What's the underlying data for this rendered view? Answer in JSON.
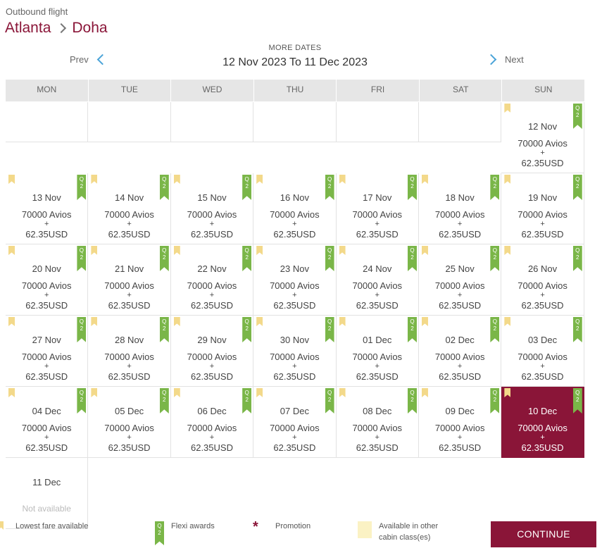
{
  "header": {
    "subtitle": "Outbound flight",
    "origin": "Atlanta",
    "destination": "Doha"
  },
  "nav": {
    "prev_label": "Prev",
    "next_label": "Next",
    "more_dates": "MORE DATES",
    "range": "12 Nov 2023 To 11 Dec 2023"
  },
  "weekdays": [
    "MON",
    "TUE",
    "WED",
    "THU",
    "FRI",
    "SAT",
    "SUN"
  ],
  "fare": {
    "avios": "70000  Avios",
    "plus": "+",
    "usd": "62.35USD"
  },
  "flexi_badge": "Q2",
  "days": [
    {
      "date": "12 Nov"
    },
    {
      "date": "13 Nov"
    },
    {
      "date": "14 Nov"
    },
    {
      "date": "15 Nov"
    },
    {
      "date": "16 Nov"
    },
    {
      "date": "17 Nov"
    },
    {
      "date": "18 Nov"
    },
    {
      "date": "19 Nov"
    },
    {
      "date": "20 Nov"
    },
    {
      "date": "21 Nov"
    },
    {
      "date": "22 Nov"
    },
    {
      "date": "23 Nov"
    },
    {
      "date": "24 Nov"
    },
    {
      "date": "25 Nov"
    },
    {
      "date": "26 Nov"
    },
    {
      "date": "27 Nov"
    },
    {
      "date": "28 Nov"
    },
    {
      "date": "29 Nov"
    },
    {
      "date": "30 Nov"
    },
    {
      "date": "01 Dec"
    },
    {
      "date": "02 Dec"
    },
    {
      "date": "03 Dec"
    },
    {
      "date": "04 Dec"
    },
    {
      "date": "05 Dec"
    },
    {
      "date": "06 Dec"
    },
    {
      "date": "07 Dec"
    },
    {
      "date": "08 Dec"
    },
    {
      "date": "09 Dec"
    },
    {
      "date": "10 Dec",
      "selected": true
    },
    {
      "date": "11 Dec",
      "available": false
    }
  ],
  "not_available": "Not available",
  "legend": {
    "lowest": "Lowest fare available",
    "flexi": "Flexi awards",
    "promotion": "Promotion",
    "cabin_line1": "Available in other",
    "cabin_line2": "cabin class(es)"
  },
  "continue_label": "CONTINUE",
  "colors": {
    "brand": "#8a1538",
    "flexi": "#7ab648",
    "lowest": "#f3d98a",
    "cabin": "#fbf2c4",
    "chevron": "#4aa3d8"
  }
}
